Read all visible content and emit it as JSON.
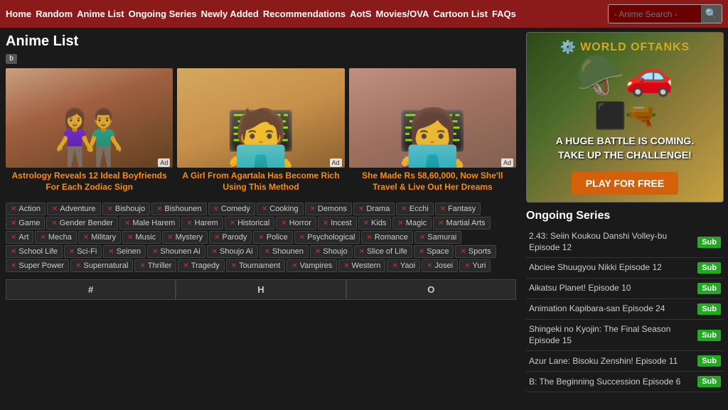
{
  "nav": {
    "links": [
      "Home",
      "Random",
      "Anime List",
      "Ongoing Series",
      "Newly Added",
      "Recommendations",
      "AotS",
      "Movies/OVA",
      "Cartoon List",
      "FAQs"
    ],
    "search_placeholder": "- Anime Search -"
  },
  "page": {
    "title": "Anime List"
  },
  "ad_cards": [
    {
      "id": "ad1",
      "title": "Astrology Reveals 12 Ideal Boyfriends For Each Zodiac Sign",
      "bg": "linear-gradient(160deg,#c8a080 0%,#a06040 40%,#604020 100%)"
    },
    {
      "id": "ad2",
      "title": "A Girl From Agartala Has Become Rich Using This Method",
      "bg": "linear-gradient(160deg,#d4a860 0%,#c8904a 50%,#8b6030 100%)"
    },
    {
      "id": "ad3",
      "title": "She Made Rs 58,60,000, Now She'll Travel & Live Out Her Dreams",
      "bg": "linear-gradient(160deg,#c09080 0%,#a07060 50%,#806050 100%)"
    }
  ],
  "tags": [
    "Action",
    "Adventure",
    "Bishoujo",
    "Bishounen",
    "Comedy",
    "Cooking",
    "Demons",
    "Drama",
    "Ecchi",
    "Fantasy",
    "Game",
    "Gender Bender",
    "Male Harem",
    "Harem",
    "Historical",
    "Horror",
    "Incest",
    "Kids",
    "Magic",
    "Martial Arts",
    "Art",
    "Mecha",
    "Military",
    "Music",
    "Mystery",
    "Parody",
    "Police",
    "Psychological",
    "Romance",
    "Samurai",
    "School Life",
    "Sci-Fi",
    "Seinen",
    "Shounen Ai",
    "Shoujo Ai",
    "Shounen",
    "Shoujo",
    "Slice of Life",
    "Space",
    "Sports",
    "Super Power",
    "Supernatural",
    "Thriller",
    "Tragedy",
    "Tournament",
    "Vampires",
    "Western",
    "Yaoi",
    "Josei",
    "Yuri"
  ],
  "alpha_tabs": [
    "#",
    "H",
    "O"
  ],
  "sidebar": {
    "wot": {
      "logo": "WORLD",
      "logo2": "OF",
      "logo3": "TANKS",
      "tagline": "A HUGE BATTLE IS COMING.\nTAKE UP THE CHALLENGE!",
      "cta": "PLAY FOR FREE"
    },
    "ongoing_title": "Ongoing Series",
    "series": [
      {
        "name": "2.43: Seiin Koukou Danshi Volley-bu Episode 12",
        "badge": "Sub"
      },
      {
        "name": "Abciee Shuugyou Nikki Episode 12",
        "badge": "Sub"
      },
      {
        "name": "Aikatsu Planet! Episode 10",
        "badge": "Sub"
      },
      {
        "name": "Animation Kapibara-san Episode 24",
        "badge": "Sub"
      },
      {
        "name": "Shingeki no Kyojin: The Final Season Episode 15",
        "badge": "Sub"
      },
      {
        "name": "Azur Lane: Bisoku Zenshin! Episode 11",
        "badge": "Sub"
      },
      {
        "name": "B: The Beginning Succession Episode 6",
        "badge": "Sub"
      }
    ]
  }
}
